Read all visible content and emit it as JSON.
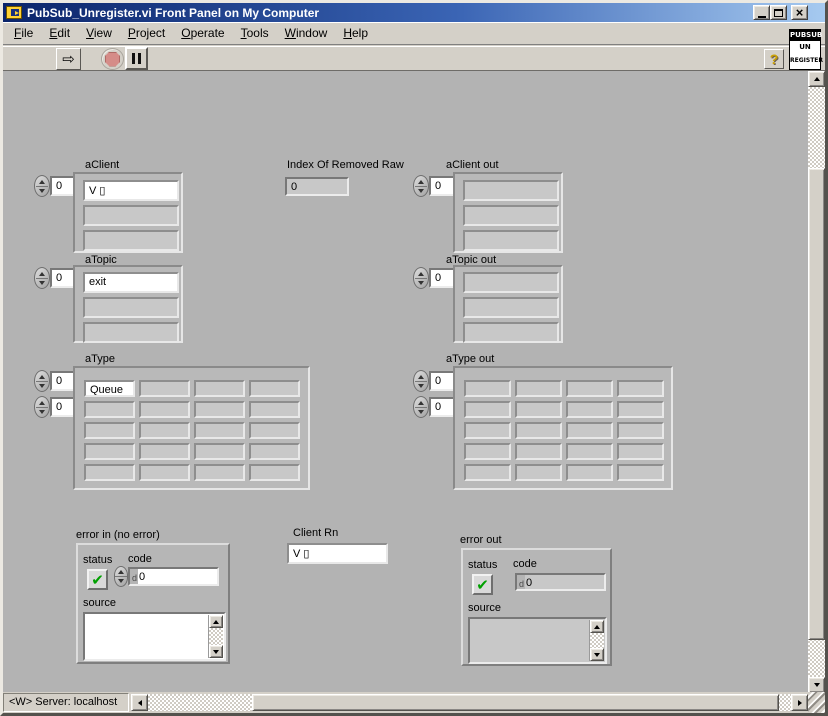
{
  "window": {
    "title": "PubSub_Unregister.vi Front Panel on My Computer",
    "buttons": [
      "minimize",
      "maximize",
      "close"
    ]
  },
  "menu": {
    "items": [
      "File",
      "Edit",
      "View",
      "Project",
      "Operate",
      "Tools",
      "Window",
      "Help"
    ]
  },
  "toolbar": {
    "run_icon": "run-arrow",
    "stop_icon": "stop-octagon",
    "pause_icon": "pause-bars",
    "help_glyph": "?"
  },
  "vi_icon": {
    "line1": "PUBSUB",
    "line2": "UN",
    "line3": "REGISTER"
  },
  "panel": {
    "aClient": {
      "label": "aClient",
      "index": "0",
      "items": [
        "V ▯",
        "",
        ""
      ]
    },
    "index_of_removed_raw": {
      "label": "Index Of Removed Raw",
      "value": "0"
    },
    "aClient_out": {
      "label": "aClient out",
      "index": "0",
      "items": [
        "",
        "",
        ""
      ]
    },
    "aTopic": {
      "label": "aTopic",
      "index": "0",
      "items": [
        "exit",
        "",
        ""
      ]
    },
    "aTopic_out": {
      "label": "aTopic out",
      "index": "0",
      "items": [
        "",
        "",
        ""
      ]
    },
    "aType": {
      "label": "aType",
      "row_index": "0",
      "col_index": "0",
      "cells": [
        [
          "Queue",
          "",
          "",
          ""
        ],
        [
          "",
          "",
          "",
          ""
        ],
        [
          "",
          "",
          "",
          ""
        ],
        [
          "",
          "",
          "",
          ""
        ],
        [
          "",
          "",
          "",
          ""
        ]
      ]
    },
    "aType_out": {
      "label": "aType out",
      "row_index": "0",
      "col_index": "0",
      "cells": [
        [
          "",
          "",
          "",
          ""
        ],
        [
          "",
          "",
          "",
          ""
        ],
        [
          "",
          "",
          "",
          ""
        ],
        [
          "",
          "",
          "",
          ""
        ],
        [
          "",
          "",
          "",
          ""
        ]
      ]
    },
    "error_in": {
      "label": "error in (no error)",
      "status_label": "status",
      "code_label": "code",
      "source_label": "source",
      "status_check": "✔",
      "code_radix": "d",
      "code_value": "0",
      "source_value": ""
    },
    "client_rn": {
      "label": "Client Rn",
      "value": "V ▯"
    },
    "error_out": {
      "label": "error out",
      "status_label": "status",
      "code_label": "code",
      "source_label": "source",
      "status_check": "✔",
      "code_radix": "d",
      "code_value": "0",
      "source_value": ""
    }
  },
  "status_bar": {
    "text": "<W> Server: localhost"
  },
  "colors": {
    "titlebar_left": "#0a246a",
    "titlebar_right": "#a6caf0",
    "chrome": "#d4d0c8",
    "panel_gray": "#b3b3b3",
    "dimmed_cell": "#c8c8c8",
    "check_green": "#00a000",
    "stop_red": "#d58c88"
  }
}
